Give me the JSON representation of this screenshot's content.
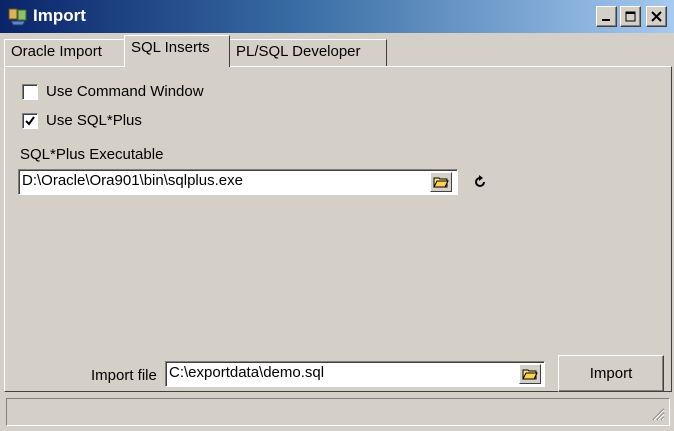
{
  "window": {
    "title": "Import",
    "icons": {
      "app": "import-app-icon",
      "minimize": "minimize-icon",
      "maximize": "maximize-icon",
      "close": "close-icon"
    }
  },
  "tabs": [
    {
      "label": "Oracle Import",
      "selected": false
    },
    {
      "label": "SQL Inserts",
      "selected": true
    },
    {
      "label": "PL/SQL Developer",
      "selected": false
    }
  ],
  "options": {
    "use_command_window": {
      "label": "Use Command Window",
      "checked": false
    },
    "use_sqlplus": {
      "label": "Use SQL*Plus",
      "checked": true
    }
  },
  "sqlplus": {
    "label": "SQL*Plus Executable",
    "value": "D:\\Oracle\\Ora901\\bin\\sqlplus.exe",
    "browse_icon": "folder-open-icon",
    "refresh_icon": "refresh-icon"
  },
  "import_file": {
    "label": "Import file",
    "value": "C:\\exportdata\\demo.sql",
    "browse_icon": "folder-open-icon"
  },
  "actions": {
    "import_label": "Import"
  },
  "colors": {
    "titlebar_start": "#0a246a",
    "titlebar_end": "#a6caf0",
    "face": "#d4d0c8"
  }
}
